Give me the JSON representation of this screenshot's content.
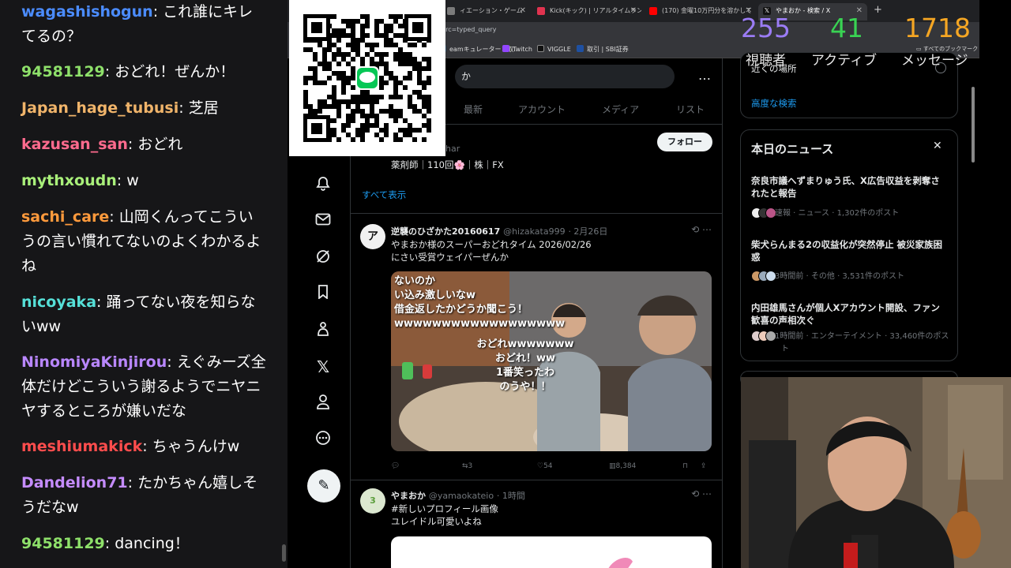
{
  "chat": {
    "messages": [
      {
        "user": "wagashishogun",
        "text": "これ誰にキレてるの？",
        "color": "#4b8cff"
      },
      {
        "user": "94581129",
        "text": "おどれ！ぜんか！",
        "color": "#8ee06a"
      },
      {
        "user": "Japan_hage_tubusi",
        "text": "芝居",
        "color": "#f0b46a"
      },
      {
        "user": "kazusan_san",
        "text": "おどれ",
        "color": "#ff6b8e"
      },
      {
        "user": "mythxoudn",
        "text": "w",
        "color": "#a9f07a"
      },
      {
        "user": "sachi_care",
        "text": "山岡くんってこういうの言い慣れてないのよくわかるよね",
        "color": "#ff9a3c"
      },
      {
        "user": "nicoyaka",
        "text": "踊ってない夜を知らないww",
        "color": "#56e0d8"
      },
      {
        "user": "NinomiyaKinjirou",
        "text": "えぐみーズ全体だけどこういう謝るようでニヤニヤするところが嫌いだな",
        "color": "#b987ff"
      },
      {
        "user": "meshiumakick",
        "text": "ちゃうんけw",
        "color": "#ff4d4d"
      },
      {
        "user": "Dandelion71",
        "text": "たかちゃん嬉しそうだなw",
        "color": "#c58cff"
      },
      {
        "user": "94581129",
        "text": "dancing！",
        "color": "#8ee06a"
      }
    ]
  },
  "browser": {
    "tabs": [
      {
        "label": "ィエーション・ゲーム",
        "fav": "#7b7b7b"
      },
      {
        "label": "Kick(キック) | リアルタイムランキン",
        "fav": "#e0334f"
      },
      {
        "label": "(170) 金曜10万円分を溶かして",
        "fav": "#ff0000"
      },
      {
        "label": "やまおか - 検索 / X",
        "fav": "#111"
      }
    ],
    "new_tab": "+",
    "url": "src=typed_query",
    "bookmarks": [
      {
        "label": "eamキュレーター：収...",
        "fav": "#2a475e"
      },
      {
        "label": "Twitch",
        "fav": "#9146ff"
      },
      {
        "label": "VIGGLE",
        "fav": "#111"
      },
      {
        "label": "取引 | SBI証券",
        "fav": "#1e50a2"
      }
    ],
    "all_bookmarks": "すべてのブックマーク"
  },
  "stream_stats": {
    "viewers": "255",
    "viewers_label": "視聴者",
    "active": "41",
    "active_label": "アクティブ",
    "messages": "1718",
    "messages_label": "メッセージ"
  },
  "x": {
    "search_value": "か",
    "more": "…",
    "tabs": [
      "最新",
      "アカウント",
      "メディア",
      "リスト"
    ],
    "user_card": {
      "handle_partial": "har",
      "bio": "薬剤師｜110回🌸｜株｜FX",
      "follow_label": "フォロー",
      "show_all": "すべて表示"
    },
    "tweets": [
      {
        "name": "逆襲のひざかた20160617",
        "handle": "@hizakata999",
        "time": "· 2月26日",
        "line1": "やまおか様のスーパーおどれタイム 2026/02/26",
        "line2": "にさい受賞ウェイパーぜんか",
        "image_text": [
          "ないのか",
          "い込み激しいなw",
          "借金返したかどうか聞こう！",
          "wwwwwwwwwwwwwwwwww",
          "おどれwwwwwww",
          "おどれ！ww",
          "1番笑ったわ",
          "のうや！！"
        ],
        "replies": "",
        "retweets": "3",
        "likes": "54",
        "views": "8,384"
      },
      {
        "name": "やまおか",
        "handle": "@yamaokateio",
        "time": "· 1時間",
        "line1": "#新しいプロフィール画像",
        "line2": "ユレイドル可愛いよね"
      }
    ],
    "right": {
      "near_place": "近くの場所",
      "advanced_search": "高度な検索",
      "news_header": "本日のニュース",
      "news": [
        {
          "title": "奈良市議へずまりゅう氏、X広告収益を剥奪されたと報告",
          "meta": "速報 · ニュース · 1,302件のポスト"
        },
        {
          "title": "柴犬らんまる2の収益化が突然停止 被災家族困惑",
          "meta": "3時間前 · その他 · 3,531件のポスト"
        },
        {
          "title": "内田雄馬さんが個人Xアカウント開設、ファン歓喜の声相次ぐ",
          "meta": "1時間前 · エンターテイメント · 33,460件のポスト"
        }
      ]
    }
  }
}
